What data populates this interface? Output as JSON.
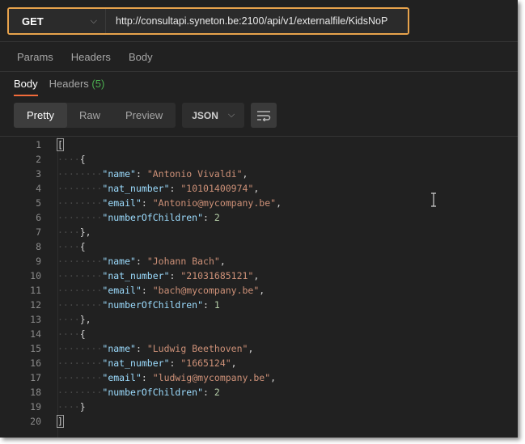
{
  "request": {
    "method": "GET",
    "url": "http://consultapi.syneton.be:2100/api/v1/externalfile/KidsNoP"
  },
  "request_tabs": [
    "Params",
    "Headers",
    "Body"
  ],
  "response_tabs": {
    "body": "Body",
    "headers": "Headers",
    "headers_count": "(5)"
  },
  "view_modes": [
    "Pretty",
    "Raw",
    "Preview"
  ],
  "language": "JSON",
  "records": [
    {
      "name": "Antonio Vivaldi",
      "nat_number": "10101400974",
      "email": "Antonio@mycompany.be",
      "numberOfChildren": "2"
    },
    {
      "name": "Johann Bach",
      "nat_number": "21031685121",
      "email": "bach@mycompany.be",
      "numberOfChildren": "1"
    },
    {
      "name": "Ludwig Beethoven",
      "nat_number": "1665124",
      "email": "ludwig@mycompany.be",
      "numberOfChildren": "2"
    }
  ],
  "colors": {
    "highlight": "#e8a34c",
    "active_tab": "#f26b3a",
    "count": "#4caf50",
    "key": "#9cdcfe",
    "string": "#ce9178",
    "number": "#b5cea8"
  }
}
